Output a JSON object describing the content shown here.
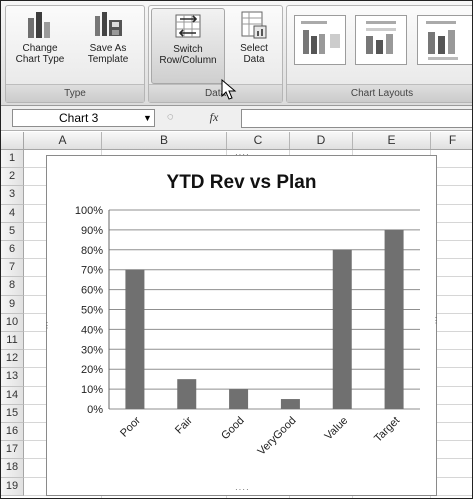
{
  "ribbon": {
    "type_group": {
      "label": "Type",
      "buttons": [
        {
          "label": "Change\nChart Type",
          "icon": "change-chart-type-icon"
        },
        {
          "label": "Save As\nTemplate",
          "icon": "save-as-template-icon"
        }
      ]
    },
    "data_group": {
      "label": "Data",
      "buttons": [
        {
          "label": "Switch\nRow/Column",
          "icon": "switch-row-column-icon"
        },
        {
          "label": "Select\nData",
          "icon": "select-data-icon"
        }
      ]
    },
    "layouts_group": {
      "label": "Chart Layouts"
    }
  },
  "formula_bar": {
    "name_box": "Chart 3",
    "fx": "fx",
    "formula": ""
  },
  "sheet": {
    "columns": [
      "A",
      "B",
      "C",
      "D",
      "E",
      "F"
    ],
    "rows": [
      "1",
      "2",
      "3",
      "4",
      "5",
      "6",
      "7",
      "8",
      "9",
      "10",
      "11",
      "12",
      "13",
      "14",
      "15",
      "16",
      "17",
      "18",
      "19"
    ]
  },
  "chart_data": {
    "type": "bar",
    "title": "YTD Rev vs Plan",
    "categories": [
      "Poor",
      "Fair",
      "Good",
      "VeryGood",
      "Value",
      "Target"
    ],
    "values": [
      0.7,
      0.15,
      0.1,
      0.05,
      0.8,
      0.9
    ],
    "ylim": [
      0,
      1
    ],
    "yticks": [
      "0%",
      "10%",
      "20%",
      "30%",
      "40%",
      "50%",
      "60%",
      "70%",
      "80%",
      "90%",
      "100%"
    ],
    "xlabel": "",
    "ylabel": "",
    "grid": true,
    "bar_color": "#707070",
    "legend": "none"
  }
}
